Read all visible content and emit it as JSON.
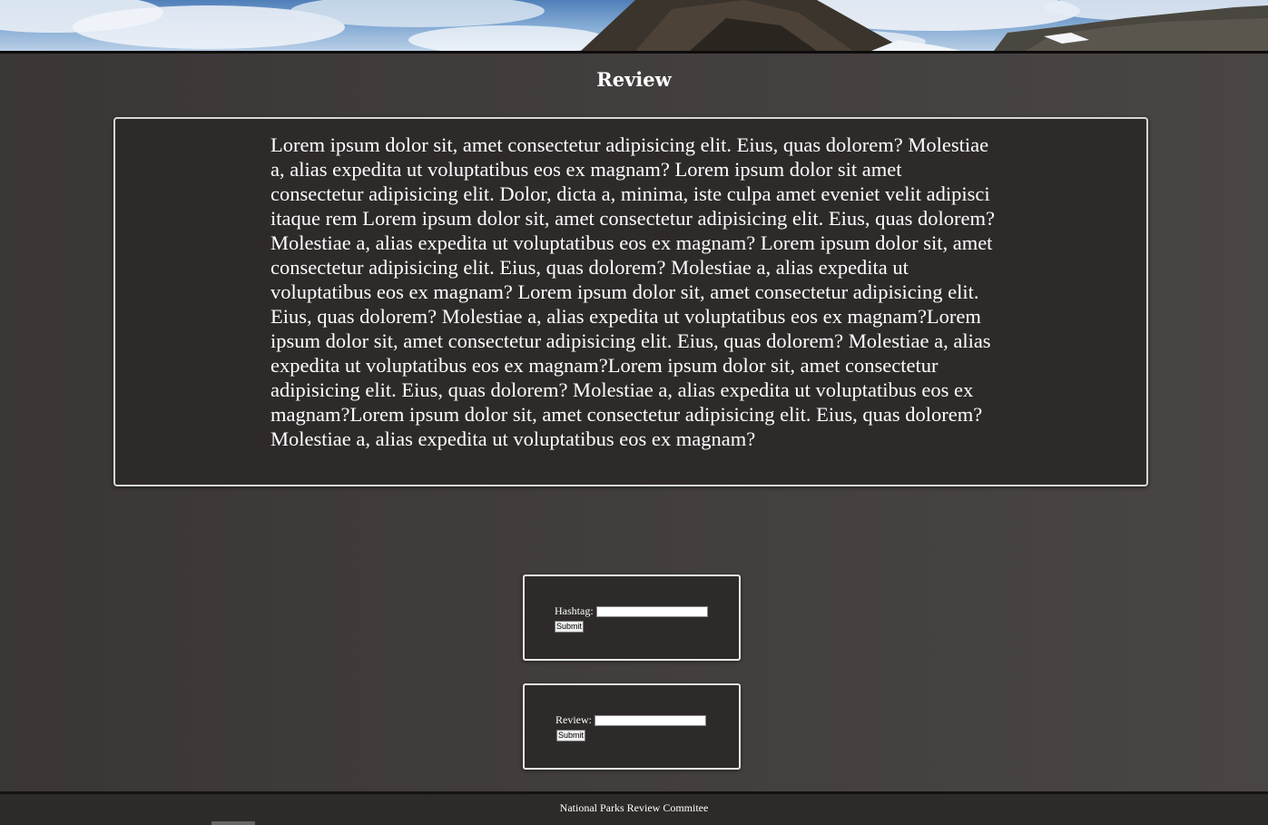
{
  "banner": {
    "alt": "Mountain landscape banner"
  },
  "page": {
    "title": "Review"
  },
  "review": {
    "text": "Lorem ipsum dolor sit, amet consectetur adipisicing elit. Eius, quas dolorem? Molestiae a, alias expedita ut voluptatibus eos ex magnam? Lorem ipsum dolor sit amet consectetur adipisicing elit. Dolor, dicta a, minima, iste culpa amet eveniet velit adipisci itaque rem Lorem ipsum dolor sit, amet consectetur adipisicing elit. Eius, quas dolorem? Molestiae a, alias expedita ut voluptatibus eos ex magnam? Lorem ipsum dolor sit, amet consectetur adipisicing elit. Eius, quas dolorem? Molestiae a, alias expedita ut voluptatibus eos ex magnam? Lorem ipsum dolor sit, amet consectetur adipisicing elit. Eius, quas dolorem? Molestiae a, alias expedita ut voluptatibus eos ex magnam?Lorem ipsum dolor sit, amet consectetur adipisicing elit. Eius, quas dolorem? Molestiae a, alias expedita ut voluptatibus eos ex magnam?Lorem ipsum dolor sit, amet consectetur adipisicing elit. Eius, quas dolorem? Molestiae a, alias expedita ut voluptatibus eos ex magnam?Lorem ipsum dolor sit, amet consectetur adipisicing elit. Eius, quas dolorem? Molestiae a, alias expedita ut voluptatibus eos ex magnam?"
  },
  "hashtag_form": {
    "label": "Hashtag:",
    "value": "",
    "submit_label": "Submit"
  },
  "review_form": {
    "label": "Review:",
    "value": "",
    "submit_label": "Submit"
  },
  "footer": {
    "text": "National Parks Review Commitee"
  },
  "colors": {
    "background": "#403b3b",
    "card": "#2f2a2a",
    "card_border": "#d7d7d7",
    "text": "#ffffff"
  }
}
